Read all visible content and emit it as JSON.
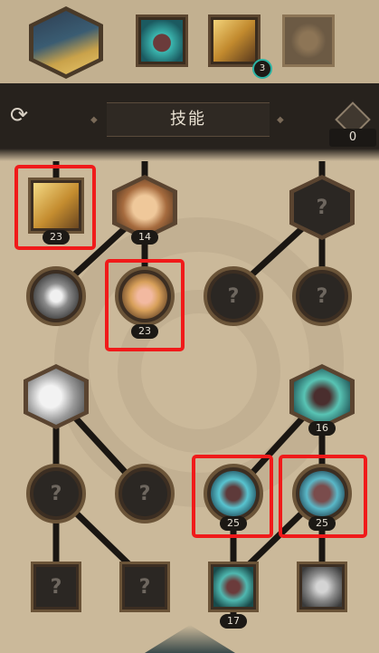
{
  "header": {
    "title": "技能",
    "currency_count": "0",
    "slot_badge": "3"
  },
  "tree_nodes": [
    {
      "id": "row1-col1",
      "level": "23"
    },
    {
      "id": "row1-col2",
      "level": "14"
    },
    {
      "id": "row2-col2",
      "level": "23"
    },
    {
      "id": "row3-col4",
      "level": "16"
    },
    {
      "id": "row4-col3",
      "level": "25"
    },
    {
      "id": "row4-col4",
      "level": "25"
    },
    {
      "id": "row5-col3",
      "level": "17"
    }
  ],
  "locked_symbol": "?",
  "colors": {
    "highlight": "#f01a1a",
    "teal_badge": "#2bb3a3"
  }
}
